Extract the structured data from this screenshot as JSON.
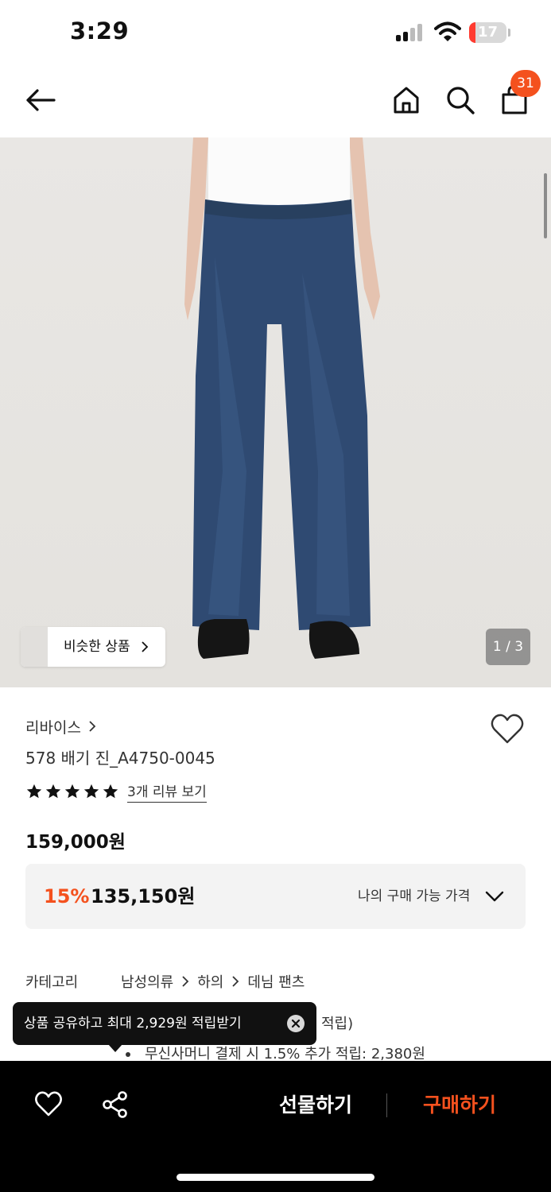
{
  "status_bar": {
    "time": "3:29",
    "battery": "17",
    "battery_level": 0.17,
    "battery_color": "#ff3b30"
  },
  "header": {
    "cart_count": "31",
    "badge_color": "#f4511e"
  },
  "gallery": {
    "similar_label": "비슷한 상품",
    "counter": "1 / 3"
  },
  "product": {
    "brand": "리바이스",
    "name": "578 배기 진_A4750-0045",
    "rating_stars": 5,
    "review_link": "3개 리뷰 보기",
    "original_price": "159,000원",
    "discount_rate": "15%",
    "sale_price": "135,150원",
    "my_price_label": "나의 구매 가능 가격"
  },
  "category": {
    "label": "카테고리",
    "path": [
      "남성의류",
      "하의",
      "데님 팬츠"
    ]
  },
  "points": {
    "partial_text": "적립)",
    "line": "무신사머니 결제 시 1.5% 추가 적립: 2,380원"
  },
  "toast": {
    "text": "상품 공유하고 최대 2,929원 적립받기"
  },
  "bottom_bar": {
    "gift_label": "선물하기",
    "buy_label": "구매하기"
  },
  "colors": {
    "accent": "#f4511e",
    "bottom_bar": "#000000"
  },
  "icons": [
    "back-arrow-icon",
    "home-icon",
    "search-icon",
    "cart-icon",
    "heart-icon",
    "star-icon",
    "chevron-right-icon",
    "chevron-down-icon",
    "close-icon",
    "share-icon"
  ]
}
